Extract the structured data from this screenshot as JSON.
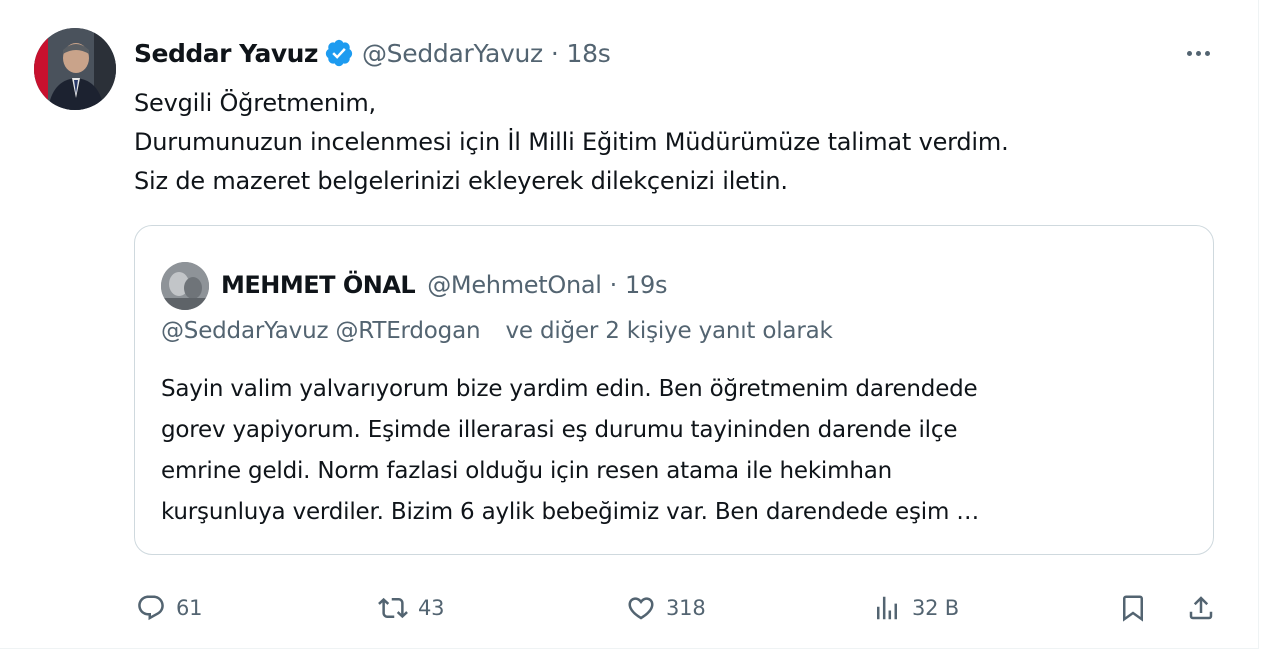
{
  "author": {
    "name": "Seddar Yavuz",
    "handle": "@SeddarYavuz",
    "separator": "·",
    "time": "18s",
    "verified_color": "#1d9bf0"
  },
  "more_menu_icon": "more-horizontal-icon",
  "body_lines": [
    "Sevgili Öğretmenim,",
    "Durumunuzun incelenmesi için İl Milli Eğitim Müdürümüze talimat verdim.",
    "Siz de mazeret belgelerinizi ekleyerek dilekçenizi iletin."
  ],
  "quoted": {
    "name": "MEHMET ÖNAL",
    "handle": "@MehmetOnal",
    "separator": "·",
    "time": "19s",
    "reply_to": {
      "mention1": "@SeddarYavuz",
      "mention2": "@RTErdogan",
      "suffix": "ve diğer 2 kişiye yanıt olarak"
    },
    "body_lines": [
      "Sayin valim yalvarıyorum bize yardim edin. Ben öğretmenim darendede",
      "gorev yapiyorum. Eşimde illerarasi eş durumu tayininden darende ilçe",
      "emrine geldi. Norm fazlasi olduğu için resen atama ile hekimhan",
      "kurşunluya verdiler. Bizim 6 aylik bebeğimiz var. Ben darendede eşim …"
    ]
  },
  "actions": {
    "reply": {
      "icon": "reply-icon",
      "count": "61"
    },
    "retweet": {
      "icon": "retweet-icon",
      "count": "43"
    },
    "like": {
      "icon": "heart-icon",
      "count": "318"
    },
    "views": {
      "icon": "views-icon",
      "count": "32 B"
    },
    "bookmark": {
      "icon": "bookmark-icon"
    },
    "share": {
      "icon": "share-icon"
    }
  },
  "colors": {
    "text": "#0f1419",
    "secondary": "#536471",
    "border": "#cfd9de",
    "accent": "#1d9bf0"
  }
}
